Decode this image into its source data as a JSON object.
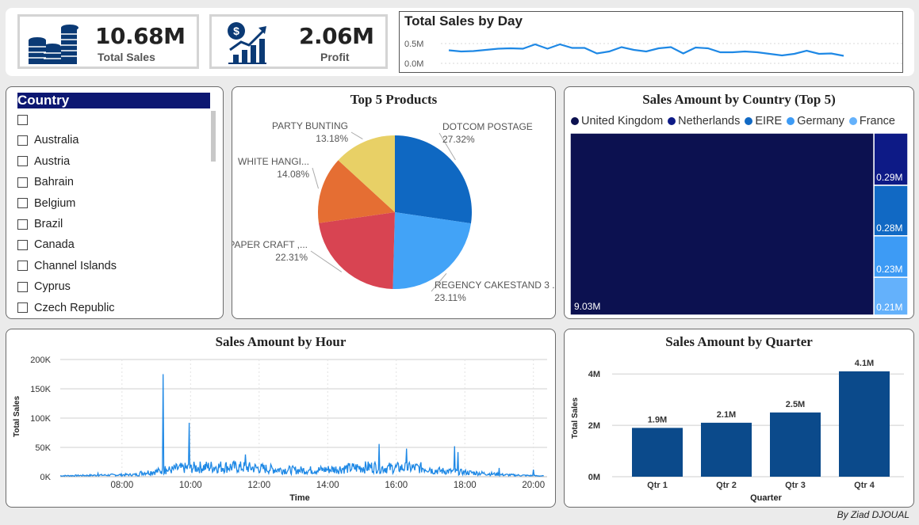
{
  "kpis": {
    "sales": {
      "value": "10.68M",
      "label": "Total Sales",
      "icon": "coin-stack-icon"
    },
    "profit": {
      "value": "2.06M",
      "label": "Profit",
      "icon": "profit-growth-icon"
    }
  },
  "colors": {
    "navy": "#0c1150",
    "blue1": "#0f5bb5",
    "blue2": "#1874cd",
    "blue3": "#3d9bf5",
    "blue4": "#64b1fb",
    "line": "#1e88e5",
    "bar": "#0b4a8b"
  },
  "slicer": {
    "title": "Country",
    "items": [
      "",
      "Australia",
      "Austria",
      "Bahrain",
      "Belgium",
      "Brazil",
      "Canada",
      "Channel Islands",
      "Cyprus",
      "Czech Republic"
    ]
  },
  "footer": "By Ziad DJOUAL",
  "chart_data": [
    {
      "type": "line",
      "title": "Total Sales by Day",
      "y_ticks": [
        "0.5M",
        "0.0M"
      ],
      "ylim": [
        0,
        0.6
      ],
      "grid": true,
      "y": [
        0.33,
        0.3,
        0.31,
        0.34,
        0.37,
        0.38,
        0.37,
        0.48,
        0.37,
        0.48,
        0.39,
        0.39,
        0.25,
        0.3,
        0.41,
        0.34,
        0.3,
        0.38,
        0.41,
        0.25,
        0.4,
        0.38,
        0.28,
        0.28,
        0.3,
        0.28,
        0.24,
        0.2,
        0.24,
        0.32,
        0.24,
        0.25,
        0.19
      ],
      "series": [
        {
          "values": []
        }
      ]
    },
    {
      "type": "pie",
      "title": "Top 5 Products",
      "labels": [
        "DOTCOM POSTAGE",
        "REGENCY CAKESTAND 3 ...",
        "PAPER CRAFT ,...",
        "WHITE HANGI...",
        "PARTY BUNTING"
      ],
      "values": [
        27.32,
        23.11,
        22.31,
        14.08,
        13.18
      ],
      "value_labels": [
        "27.32%",
        "23.11%",
        "22.31%",
        "14.08%",
        "13.18%"
      ],
      "colors": [
        "#0f68c2",
        "#42a3f7",
        "#d84452",
        "#e56e33",
        "#e8d066"
      ]
    },
    {
      "type": "treemap",
      "title": "Sales Amount by Country (Top 5)",
      "legend_position": "top-left",
      "categories": [
        "United Kingdom",
        "Netherlands",
        "EIRE",
        "Germany",
        "France"
      ],
      "values": [
        9.03,
        0.29,
        0.28,
        0.23,
        0.21
      ],
      "value_labels": [
        "9.03M",
        "0.29M",
        "0.28M",
        "0.23M",
        "0.21M"
      ],
      "colors": [
        "#0c1150",
        "#0d1a86",
        "#1169c4",
        "#3d9bf5",
        "#64b1fb"
      ]
    },
    {
      "type": "line",
      "title": "Sales Amount by Hour",
      "xlabel": "Time",
      "ylabel": "Total Sales",
      "x_ticks": [
        "08:00",
        "10:00",
        "12:00",
        "14:00",
        "16:00",
        "18:00",
        "20:00"
      ],
      "y_ticks": [
        "0K",
        "50K",
        "100K",
        "150K",
        "200K"
      ],
      "xlim": [
        6.2,
        20.4
      ],
      "ylim": [
        0,
        200000
      ],
      "grid": true,
      "peaks": [
        {
          "x": 7.3,
          "y": 6000
        },
        {
          "x": 9.2,
          "y": 175000
        },
        {
          "x": 9.25,
          "y": 18000
        },
        {
          "x": 9.95,
          "y": 92000
        },
        {
          "x": 10.0,
          "y": 20000
        },
        {
          "x": 11.6,
          "y": 38000
        },
        {
          "x": 15.5,
          "y": 56000
        },
        {
          "x": 16.3,
          "y": 48000
        },
        {
          "x": 17.7,
          "y": 52000
        },
        {
          "x": 17.8,
          "y": 42000
        },
        {
          "x": 19.0,
          "y": 15000
        },
        {
          "x": 20.0,
          "y": 12000
        }
      ]
    },
    {
      "type": "bar",
      "title": "Sales Amount by Quarter",
      "xlabel": "Quarter",
      "ylabel": "Total Sales",
      "categories": [
        "Qtr 1",
        "Qtr 2",
        "Qtr 3",
        "Qtr 4"
      ],
      "values": [
        1.9,
        2.1,
        2.5,
        4.1
      ],
      "value_labels": [
        "1.9M",
        "2.1M",
        "2.5M",
        "4.1M"
      ],
      "y_ticks": [
        "0M",
        "2M",
        "4M"
      ],
      "ylim": [
        0,
        4.5
      ],
      "grid": true
    }
  ]
}
